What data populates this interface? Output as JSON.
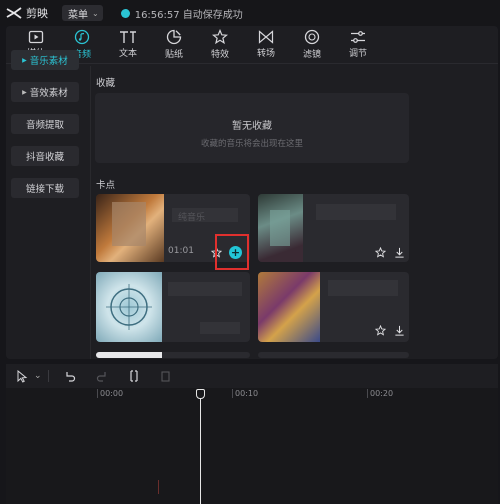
{
  "app": {
    "name": "剪映",
    "menu_label": "菜单",
    "save_status": "16:56:57 自动保存成功"
  },
  "toolbar": {
    "tabs": [
      {
        "label": "媒体",
        "icon": "media-icon"
      },
      {
        "label": "音频",
        "icon": "audio-icon",
        "active": true
      },
      {
        "label": "文本",
        "icon": "text-icon"
      },
      {
        "label": "贴纸",
        "icon": "sticker-icon"
      },
      {
        "label": "特效",
        "icon": "effects-icon"
      },
      {
        "label": "转场",
        "icon": "transition-icon"
      },
      {
        "label": "滤镜",
        "icon": "filter-icon"
      },
      {
        "label": "调节",
        "icon": "adjust-icon"
      }
    ]
  },
  "sidebar": {
    "items": [
      {
        "label": "音乐素材",
        "active": true
      },
      {
        "label": "音效素材"
      },
      {
        "label": "音频提取"
      },
      {
        "label": "抖音收藏"
      },
      {
        "label": "链接下载"
      }
    ]
  },
  "favorites": {
    "title": "收藏",
    "empty_text": "暂无收藏",
    "hint": "收藏的音乐将会出现在这里"
  },
  "beats": {
    "title": "卡点",
    "cards": [
      {
        "duration": "01:01",
        "name_fragment": "纯音乐"
      },
      {
        "duration": "",
        "name_fragment": ""
      },
      {
        "duration": "",
        "name_fragment": ""
      },
      {
        "duration": "",
        "name_fragment": ""
      }
    ]
  },
  "timeline": {
    "ruler": [
      "00:00",
      "00:10",
      "00:20"
    ]
  },
  "colors": {
    "accent": "#2bc4d4",
    "highlight": "#e0302e"
  }
}
